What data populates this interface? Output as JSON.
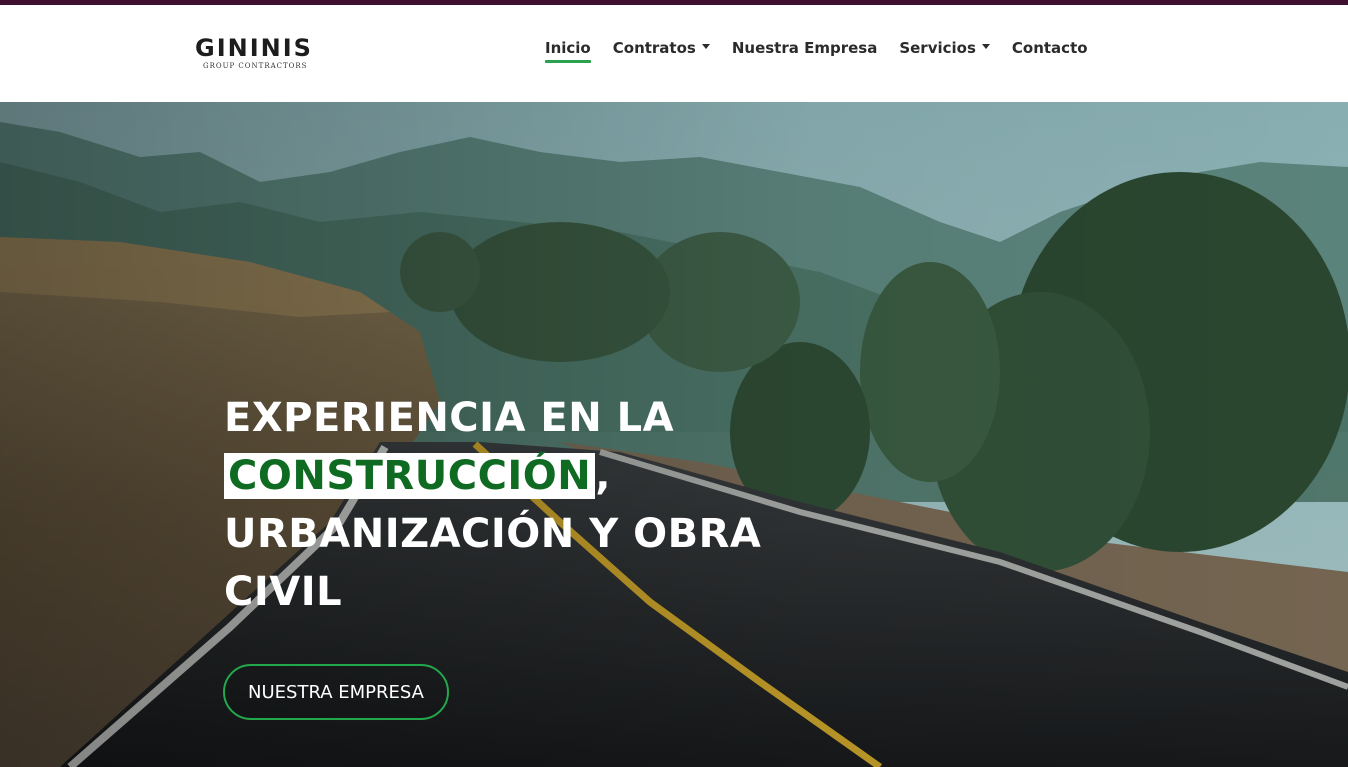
{
  "brand": {
    "name": "GININIS",
    "tagline": "GROUP CONTRACTORS"
  },
  "nav": {
    "items": [
      {
        "label": "Inicio",
        "active": true,
        "dropdown": false
      },
      {
        "label": "Contratos",
        "active": false,
        "dropdown": true
      },
      {
        "label": "Nuestra Empresa",
        "active": false,
        "dropdown": false
      },
      {
        "label": "Servicios",
        "active": false,
        "dropdown": true
      },
      {
        "label": "Contacto",
        "active": false,
        "dropdown": false
      }
    ]
  },
  "hero": {
    "headline_line1": "EXPERIENCIA EN LA",
    "headline_highlight": "CONSTRUCCIÓN",
    "headline_after_highlight": ",",
    "headline_line3": "URBANIZACIÓN Y OBRA",
    "headline_line4": "CIVIL",
    "cta_label": "NUESTRA EMPRESA",
    "image": "road-through-hills-photo"
  },
  "colors": {
    "topbar": "#3f0f30",
    "accent_green": "#22a84a",
    "highlight_text": "#0f6b22",
    "nav_text": "#2b2b2b"
  }
}
